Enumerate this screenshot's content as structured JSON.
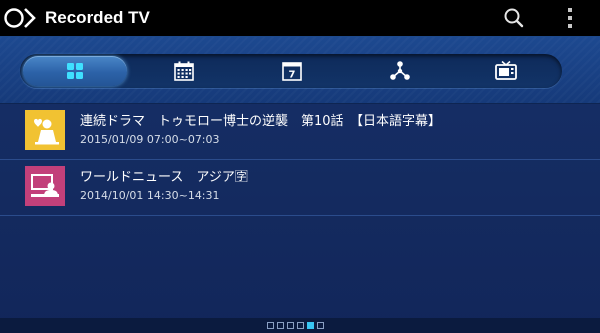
{
  "header": {
    "title": "Recorded TV",
    "logo_icon": "tv-app-logo-icon",
    "search_icon": "search-icon",
    "menu_icon": "overflow-menu-icon"
  },
  "toolbar": {
    "tabs": [
      {
        "icon": "grid-icon",
        "active": true
      },
      {
        "icon": "calendar-icon",
        "active": false
      },
      {
        "icon": "calendar-day-7-icon",
        "active": false,
        "label": "7"
      },
      {
        "icon": "share-network-icon",
        "active": false
      },
      {
        "icon": "tv-icon",
        "active": false
      }
    ]
  },
  "recordings": [
    {
      "title": "連続ドラマ　トゥモロー博士の逆襲　第10話　【日本語字幕】",
      "time": "2015/01/09 07:00~07:03",
      "category_icon": "drama-icon",
      "category_color": "#f1c232"
    },
    {
      "title": "ワールドニュース　アジア🈑",
      "time": "2014/10/01 14:30~14:31",
      "category_icon": "news-icon",
      "category_color": "#c2407a"
    }
  ],
  "pager": {
    "page_count": 6,
    "current_page": 5
  },
  "colors": {
    "accent": "#38c6f4",
    "header_bg": "#000000",
    "background": "#17306a"
  }
}
